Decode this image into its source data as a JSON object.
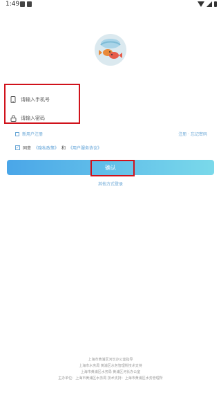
{
  "status_bar": {
    "time": "1:49"
  },
  "login": {
    "phone_placeholder": "请输入手机号",
    "password_placeholder": "请输入密码",
    "register_link": "新用户注册",
    "forgot_link": "注册 · 忘记密码",
    "agree_prefix": "同意",
    "privacy_policy": "《隐私政策》",
    "and": "和",
    "user_agreement": "《用户服务协议》",
    "confirm_label": "确认",
    "other_login": "其他方式登录"
  },
  "footer": {
    "lines": [
      "上海市黄浦区河长办公室指导",
      "上海市水务局 黄浦区水务管理所技术支持",
      "上海市黄浦区水务局 黄浦区河长办公室",
      "主办单位：上海市黄浦区水务局  技术支持：上海市黄浦区水务管理所"
    ]
  },
  "colors": {
    "button_gradient_start": "#4aa6e8",
    "button_gradient_end": "#7ad9ea",
    "link": "#6aa7d6",
    "highlight": "#d0121b"
  }
}
